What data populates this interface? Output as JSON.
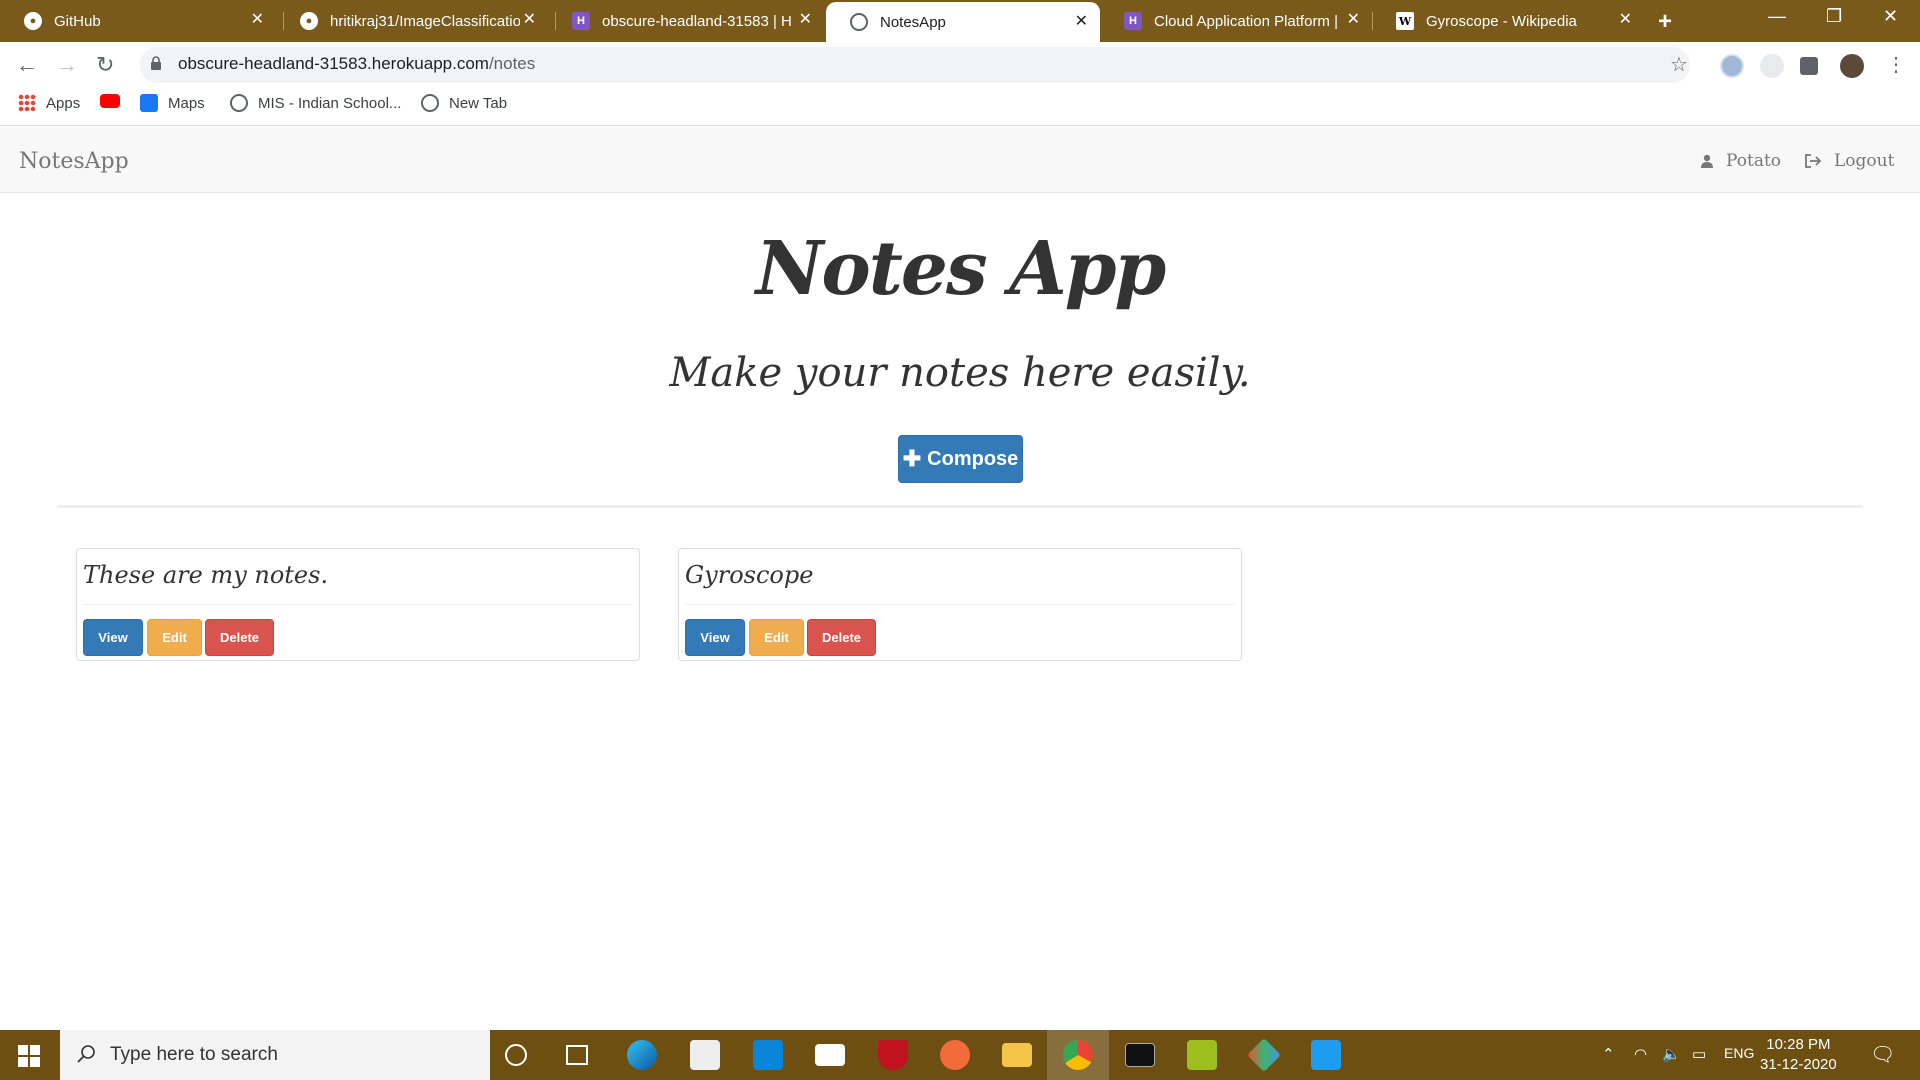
{
  "browser": {
    "tabs": [
      {
        "title": "GitHub",
        "icon": "github-icon"
      },
      {
        "title": "hritikraj31/ImageClassificatio",
        "icon": "github-icon"
      },
      {
        "title": "obscure-headland-31583 | H",
        "icon": "heroku-icon"
      },
      {
        "title": "NotesApp",
        "icon": "globe-icon"
      },
      {
        "title": "Cloud Application Platform |",
        "icon": "heroku-icon"
      },
      {
        "title": "Gyroscope - Wikipedia",
        "icon": "wikipedia-icon"
      }
    ],
    "active_tab": 3,
    "url_host": "obscure-headland-31583.herokuapp.com",
    "url_path": "/notes",
    "bookmarks": [
      "Apps",
      "",
      "Maps",
      "MIS - Indian School...",
      "New Tab"
    ]
  },
  "app": {
    "brand": "NotesApp",
    "user": "Potato",
    "logout": "Logout",
    "title": "Notes App",
    "subtitle": "Make your notes here easily.",
    "compose_label": "Compose",
    "notes": [
      {
        "title": "These are my notes.",
        "view": "View",
        "edit": "Edit",
        "delete": "Delete"
      },
      {
        "title": "Gyroscope",
        "view": "View",
        "edit": "Edit",
        "delete": "Delete"
      }
    ],
    "colors": {
      "primary": "#337ab7",
      "warning": "#f0ad4e",
      "danger": "#d9534f"
    }
  },
  "taskbar": {
    "search_placeholder": "Type here to search",
    "language": "ENG",
    "time": "10:28 PM",
    "date": "31-12-2020"
  }
}
